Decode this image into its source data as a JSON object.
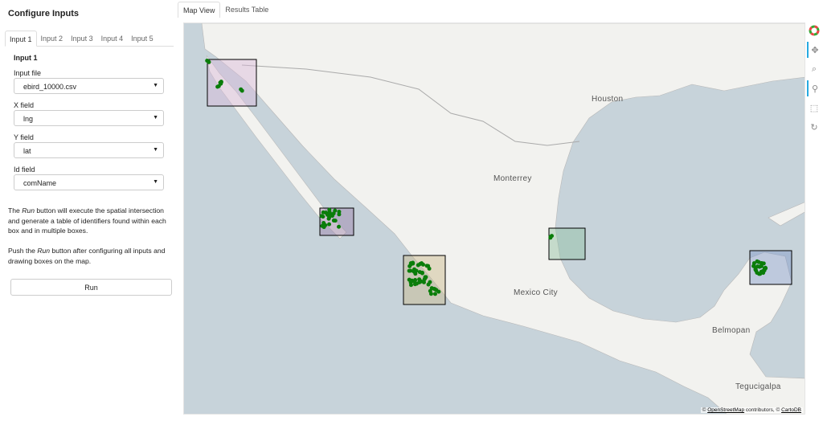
{
  "sidebar": {
    "title": "Configure Inputs",
    "tabs": [
      "Input 1",
      "Input 2",
      "Input 3",
      "Input 4",
      "Input 5"
    ],
    "section_title": "Input 1",
    "fields": [
      {
        "label": "Input file",
        "value": "ebird_10000.csv"
      },
      {
        "label": "X field",
        "value": "lng"
      },
      {
        "label": "Y field",
        "value": "lat"
      },
      {
        "label": "Id field",
        "value": "comName"
      }
    ],
    "help1_pre": "The ",
    "help1_em": "Run",
    "help1_post": " button will execute the spatial intersection and generate a table of identifiers found within each box and in multiple boxes.",
    "help2_pre": "Push the ",
    "help2_em": "Run",
    "help2_post": " button after configuring all inputs and drawing boxes on the map.",
    "run_label": "Run"
  },
  "main": {
    "tabs": [
      "Map View",
      "Results Table"
    ],
    "map": {
      "cities": [
        "Houston",
        "Monterrey",
        "Mexico City",
        "Belmopan",
        "Tegucigalpa"
      ],
      "attribution": {
        "prefix": "© ",
        "osm": "OpenStreetMap",
        "mid": " contributors, © ",
        "carto": "CartoDB"
      },
      "colors": {
        "water": "#c7d3da",
        "land": "#f2f2ef",
        "points": "#0a7d0a"
      },
      "box_colors": [
        "#d9b8d9",
        "#9b7fa8",
        "#c9b98a",
        "#8fbf9f",
        "#7f96c8"
      ]
    },
    "toolbar": [
      "bokeh-logo-icon",
      "pan-icon",
      "box-zoom-icon",
      "wheel-zoom-icon",
      "box-edit-icon",
      "reset-icon"
    ]
  }
}
